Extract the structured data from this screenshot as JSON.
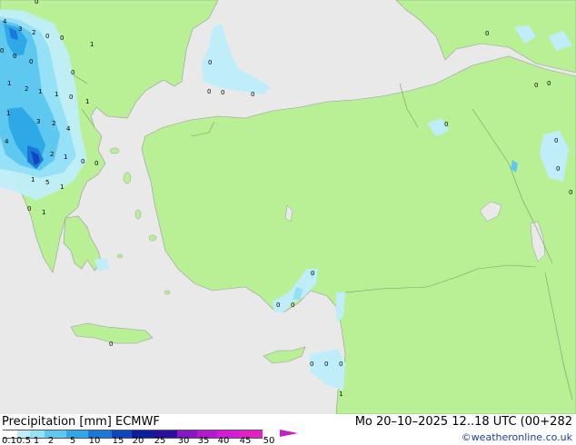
{
  "map": {
    "land_color": "#b9f095",
    "sea_color": "#e9e9e9",
    "coast_color": "#9a9a9a",
    "border_color": "#7a9a6a"
  },
  "footer": {
    "title": "Precipitation [mm]  ECMWF",
    "run": "Mo 20–10–2025 12..18 UTC (00+282",
    "credit": "©weatheronline.co.uk"
  },
  "legend": {
    "ticks": [
      "0.1",
      "0.5",
      "1",
      "2",
      "5",
      "10",
      "15",
      "20",
      "25",
      "30",
      "35",
      "40",
      "45",
      "50"
    ],
    "colors": [
      "#ffffff",
      "#bfeefa",
      "#96e0f8",
      "#5ec8f0",
      "#2fa8e8",
      "#1b78d8",
      "#1046c0",
      "#0a1ea0",
      "#2a0ea0",
      "#8a14c8",
      "#b418d0",
      "#d41cd8",
      "#e420c8",
      "#c520c5"
    ]
  },
  "labels": [
    "4",
    "3",
    "2",
    "0",
    "1",
    "0",
    "0",
    "0",
    "1",
    "2",
    "1",
    "1",
    "0",
    "1",
    "1",
    "0",
    "0",
    "0",
    "0",
    "3",
    "2",
    "4",
    "4",
    "2",
    "0",
    "1",
    "5",
    "1",
    "0",
    "1",
    "1",
    "0",
    "0",
    "0",
    "0",
    "0",
    "0",
    "0",
    "0",
    "0",
    "0",
    "0",
    "0",
    "0",
    "0",
    "0",
    "0",
    "0",
    "0",
    "1"
  ]
}
